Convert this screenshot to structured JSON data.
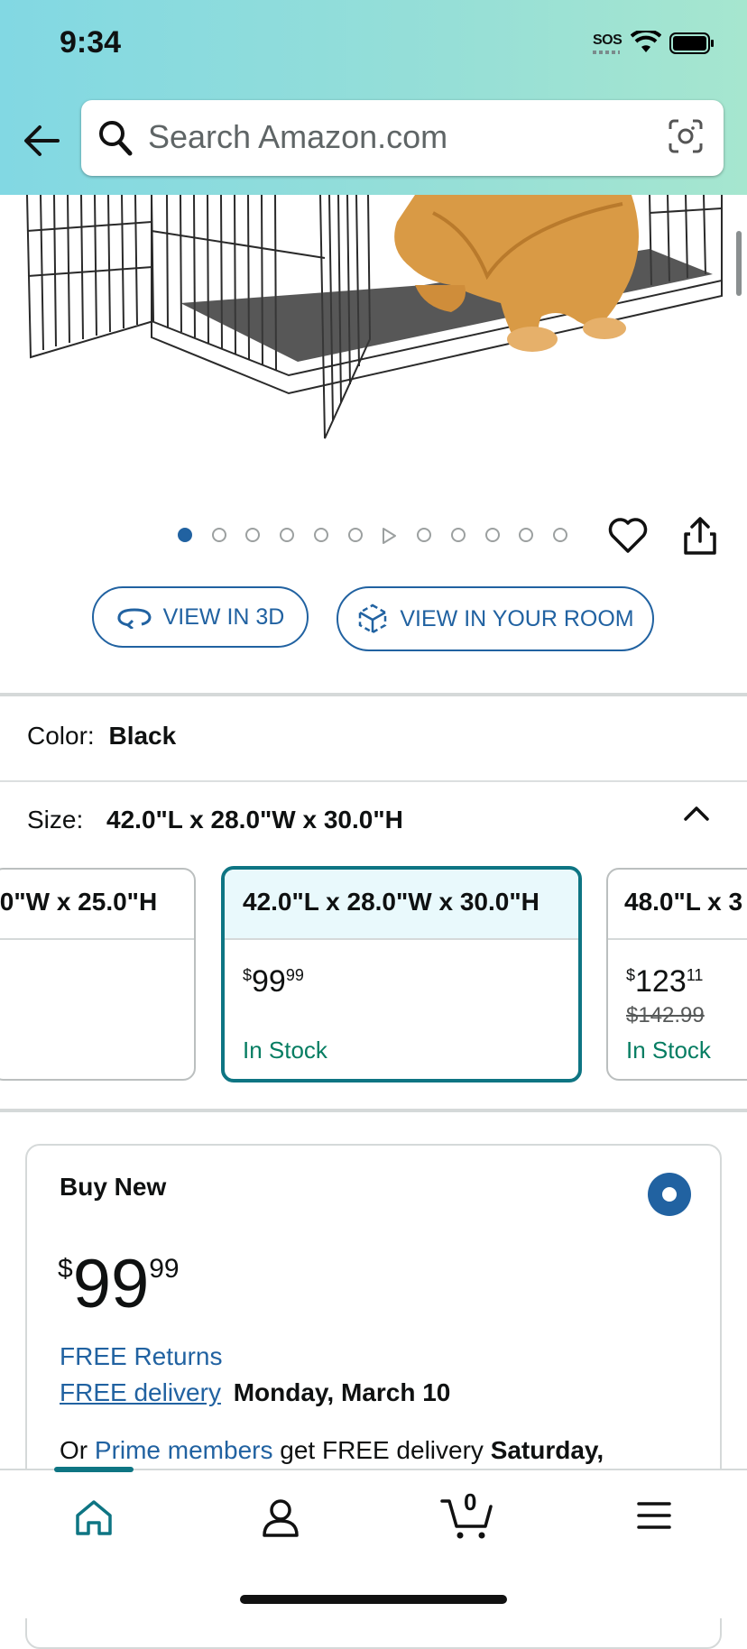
{
  "status": {
    "time": "9:34",
    "sos": "SOS"
  },
  "search": {
    "placeholder": "Search Amazon.com"
  },
  "image": {
    "dots_total": 12,
    "active_dot": 0
  },
  "view_buttons": {
    "view_3d": "VIEW IN 3D",
    "view_room": "VIEW IN YOUR ROOM"
  },
  "color": {
    "label": "Color:",
    "value": "Black"
  },
  "size": {
    "label": "Size:",
    "value": "42.0\"L x 28.0\"W x 30.0\"H",
    "options": [
      {
        "title": ".0\"W x 25.0\"H",
        "price_whole": "",
        "price_cents": "",
        "list_price": "",
        "stock": ""
      },
      {
        "title": "42.0\"L x 28.0\"W x 30.0\"H",
        "price_whole": "99",
        "price_cents": "99",
        "list_price": "",
        "stock": "In Stock"
      },
      {
        "title": "48.0\"L x 3",
        "price_whole": "123",
        "price_cents": "11",
        "list_price": "$142.99",
        "stock": "In Stock"
      }
    ]
  },
  "buy_box": {
    "title": "Buy New",
    "currency": "$",
    "price_whole": "99",
    "price_cents": "99",
    "free_returns": "FREE Returns",
    "free_delivery_link": "FREE delivery",
    "delivery_date": "Monday, March 10",
    "prime_prefix": "Or ",
    "prime_link": "Prime members",
    "prime_text": " get FREE delivery ",
    "prime_date": "Saturday,"
  },
  "bottom_nav": {
    "cart_count": "0",
    "items": [
      "home-icon",
      "account-icon",
      "cart-icon",
      "menu-icon"
    ]
  },
  "colors": {
    "accent": "#2162a1",
    "teal": "#0e7583",
    "stock_green": "#067d62"
  }
}
